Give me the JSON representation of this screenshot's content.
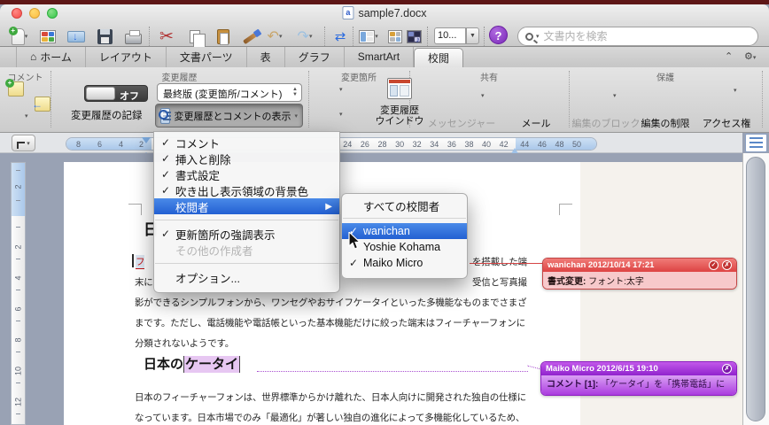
{
  "titlebar": {
    "title": "sample7.docx"
  },
  "toolbar": {
    "zoom": "10...",
    "search_placeholder": "文書内を検索"
  },
  "tabs": {
    "home": "ホーム",
    "layout": "レイアウト",
    "parts": "文書パーツ",
    "table": "表",
    "chart": "グラフ",
    "smartart": "SmartArt",
    "review": "校閲"
  },
  "ribbon": {
    "groups": {
      "comment": "コメント",
      "tracking": "変更履歴",
      "changes": "変更箇所",
      "share": "共有",
      "protect": "保護"
    },
    "tracking": {
      "toggle": "オフ",
      "record": "変更履歴の記録",
      "display": "最終版 (変更箇所/コメント)",
      "show_markup": "変更履歴とコメントの表示"
    },
    "changes": {
      "pane_line1": "変更履歴",
      "pane_line2": "ウインドウ"
    },
    "share": {
      "messenger": "メッセンジャー",
      "mail": "メール"
    },
    "protect": {
      "block": "編集のブロック",
      "restrict": "編集の制限",
      "access": "アクセス権"
    }
  },
  "menu": {
    "comments": "コメント",
    "insertions": "挿入と削除",
    "formatting": "書式設定",
    "balloon_bg": "吹き出し表示領域の背景色",
    "reviewers": "校閲者",
    "highlight": "更新箇所の強調表示",
    "other_authors": "その他の作成者",
    "options": "オプション..."
  },
  "submenu": {
    "all": "すべての校閲者",
    "wanichan": "wanichan",
    "yoshie": "Yoshie Kohama",
    "maiko": "Maiko Micro"
  },
  "ruler": {
    "h_left": [
      "8",
      "6",
      "4",
      "2"
    ],
    "h_right": [
      "24",
      "26",
      "28",
      "30",
      "32",
      "34",
      "36",
      "38",
      "40",
      "42"
    ],
    "h_margin": [
      "44",
      "46",
      "48",
      "50"
    ],
    "v_top": "2",
    "v_main": [
      "2",
      "4",
      "6",
      "8",
      "10",
      "12"
    ]
  },
  "doc": {
    "h1": "日",
    "p1l1a": "フ",
    "p1l1b": "を搭載した端",
    "p1l2a": "末に",
    "p1l2b": "受信と写真撮",
    "p1l3": "影ができるシンプルフォンから、ワンセグやおサイフケータイといった多機能なものまでさまざ",
    "p1l4": "まです。ただし、電話機能や電話帳といった基本機能だけに絞った端末はフィーチャーフォンに",
    "p1l5": "分類されないようです。",
    "h2a": "日本の",
    "h2b": "ケータイ",
    "p2l1": "日本のフィーチャーフォンは、世界標準からかけ離れた、日本人向けに開発された独自の仕様に",
    "p2l2": "なっています。日本市場でのみ「最適化」が著しい独自の進化によって多機能化しているため、"
  },
  "balloons": {
    "format": {
      "header": "wanichan 2012/10/14 17:21",
      "label": "書式変更:",
      "text": " フォント:太字"
    },
    "comment": {
      "header": "Maiko Micro 2012/6/15 19:10",
      "label": "コメント [1]:",
      "text": " 「ケータイ」を「携帯電話」に"
    }
  }
}
